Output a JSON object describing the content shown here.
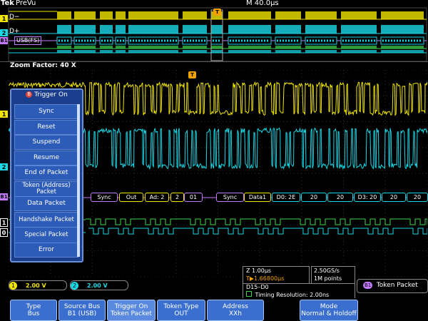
{
  "header": {
    "brand": "Tek",
    "view": "PreVu",
    "horizontal": "M 40.0μs"
  },
  "zoom": {
    "label": "Zoom Factor: 40 X"
  },
  "prevu_labels": {
    "d_minus": "D−",
    "d_plus": "D+",
    "bus": "USB(FS)",
    "ch1": "1",
    "ch2": "2",
    "b1": "B1",
    "t": "T"
  },
  "trigger_menu": {
    "title": "Trigger On",
    "title_icon": "B",
    "items": [
      "Sync",
      "Reset",
      "Suspend",
      "Resume",
      "End of Packet",
      "Token (Address) Packet",
      "Data Packet",
      "Handshake Packet",
      "Special Packet",
      "Error"
    ]
  },
  "channel_markers": {
    "ch1": "1",
    "ch2": "2",
    "b1": "B1",
    "d1": "1",
    "d0": "0",
    "t": "T"
  },
  "bus_decode": [
    "Sync",
    "Out",
    "Ad: 2",
    "2",
    "01",
    "Sync",
    "Data1",
    "D0: 2E",
    "20",
    "20",
    "D3: 20",
    "20",
    "20"
  ],
  "status": {
    "ch1_num": "1",
    "ch1_scale": "2.00 V",
    "ch2_num": "2",
    "ch2_scale": "2.00 V",
    "timebase": "Z 1.00μs",
    "trigger_pos": "T▶1.66800μs",
    "sample_rate": "2.50GS/s",
    "record_length": "1M points",
    "digital_channels": "D15–D0",
    "timing_resolution": "Timing Resolution: 2.00ns",
    "trigger_source_badge": "B1",
    "trigger_type": "Token Packet"
  },
  "soft_buttons": [
    {
      "label": "Type",
      "value": "Bus"
    },
    {
      "label": "Source Bus",
      "value": "B1 (USB)"
    },
    {
      "label": "Trigger On",
      "value": "Token Packet"
    },
    {
      "label": "Token Type",
      "value": "OUT"
    },
    {
      "label": "Address",
      "value": "XXh"
    },
    {
      "label": "Mode",
      "value": "Normal & Holdoff"
    }
  ],
  "colors": {
    "ch1": "#f2e600",
    "ch2": "#19d8e6",
    "bus": "#c47bff",
    "digital": "#3fd34a",
    "menu_bg": "#1a3e8c",
    "button": "#3a6fd0"
  }
}
